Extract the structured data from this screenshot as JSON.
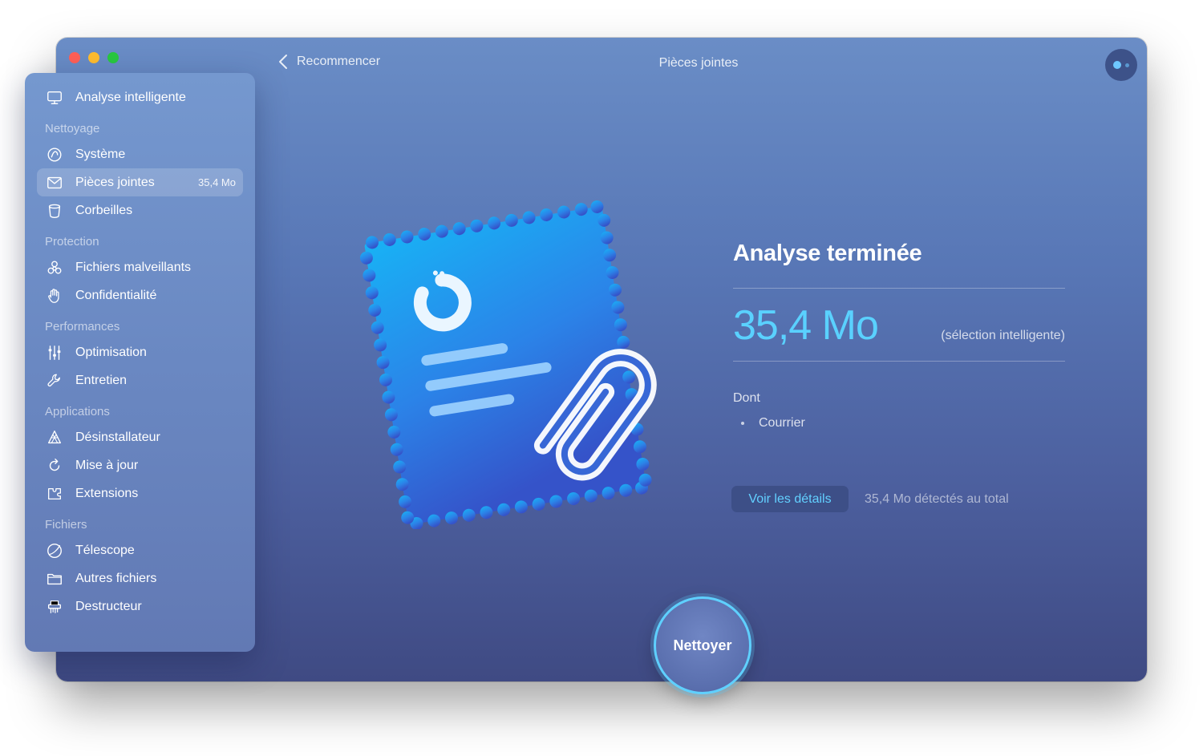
{
  "window": {
    "title": "Pièces jointes",
    "back_label": "Recommencer"
  },
  "sidebar": {
    "top_item": {
      "label": "Analyse intelligente",
      "icon": "monitor-icon"
    },
    "sections": [
      {
        "label": "Nettoyage"
      },
      {
        "label": "Protection"
      },
      {
        "label": "Performances"
      },
      {
        "label": "Applications"
      },
      {
        "label": "Fichiers"
      }
    ],
    "items": [
      {
        "label": "Système",
        "icon": "system-icon"
      },
      {
        "label": "Pièces jointes",
        "icon": "mail-icon",
        "badge": "35,4 Mo",
        "active": true
      },
      {
        "label": "Corbeilles",
        "icon": "trash-icon"
      },
      {
        "label": "Fichiers malveillants",
        "icon": "biohazard-icon"
      },
      {
        "label": "Confidentialité",
        "icon": "hand-icon"
      },
      {
        "label": "Optimisation",
        "icon": "sliders-icon"
      },
      {
        "label": "Entretien",
        "icon": "wrench-icon"
      },
      {
        "label": "Désinstallateur",
        "icon": "uninstaller-icon"
      },
      {
        "label": "Mise à jour",
        "icon": "update-icon"
      },
      {
        "label": "Extensions",
        "icon": "extensions-icon"
      },
      {
        "label": "Télescope",
        "icon": "lens-icon"
      },
      {
        "label": "Autres fichiers",
        "icon": "folder-icon"
      },
      {
        "label": "Destructeur",
        "icon": "shredder-icon"
      }
    ]
  },
  "result": {
    "title": "Analyse terminée",
    "size": "35,4 Mo",
    "size_note": "(sélection intelligente)",
    "breakdown_label": "Dont",
    "breakdown_items": [
      "Courrier"
    ],
    "details_button": "Voir les détails",
    "total_note": "35,4 Mo détectés au total"
  },
  "clean_button": "Nettoyer",
  "colors": {
    "accent": "#5ad1ff",
    "close": "#fe5f57",
    "minimize": "#febc2e",
    "maximize": "#28c840"
  }
}
